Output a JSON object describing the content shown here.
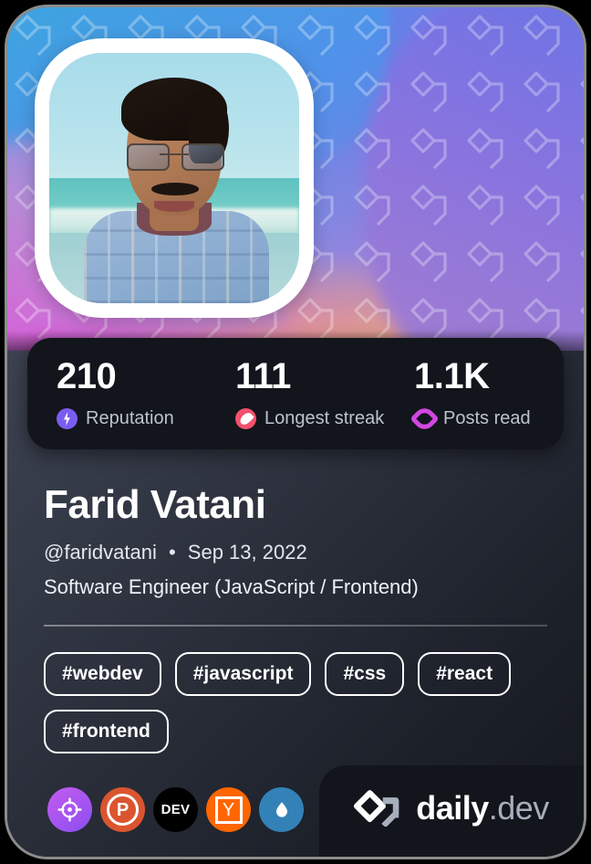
{
  "card": {
    "header": {
      "avatar_alt": "profile-photo",
      "pattern_icon": "daily-dev-watermark"
    },
    "stats": [
      {
        "value": "210",
        "label": "Reputation",
        "icon": "bolt-icon",
        "color": "#7b5cf0"
      },
      {
        "value": "111",
        "label": "Longest streak",
        "icon": "flame-icon",
        "color": "#f4516d"
      },
      {
        "value": "1.1K",
        "label": "Posts read",
        "icon": "eye-icon",
        "color": "#d247e0"
      }
    ],
    "profile": {
      "name": "Farid Vatani",
      "username": "@faridvatani",
      "separator": "•",
      "joined": "Sep 13, 2022",
      "role": "Software Engineer (JavaScript / Frontend)"
    },
    "tags": [
      "#webdev",
      "#javascript",
      "#css",
      "#react",
      "#frontend"
    ],
    "badges": [
      {
        "name": "target-badge",
        "label": "",
        "icon": "crosshair-icon"
      },
      {
        "name": "producthunt-badge",
        "label": "P",
        "icon": "producthunt-icon"
      },
      {
        "name": "devto-badge",
        "label": "DEV",
        "icon": "devto-icon"
      },
      {
        "name": "hackernews-badge",
        "label": "Y",
        "icon": "hackernews-icon"
      },
      {
        "name": "water-drop-badge",
        "label": "",
        "icon": "droplet-icon"
      }
    ],
    "footer": {
      "brand_primary": "daily",
      "brand_secondary": ".dev",
      "logo_icon": "daily-dev-logo"
    }
  }
}
